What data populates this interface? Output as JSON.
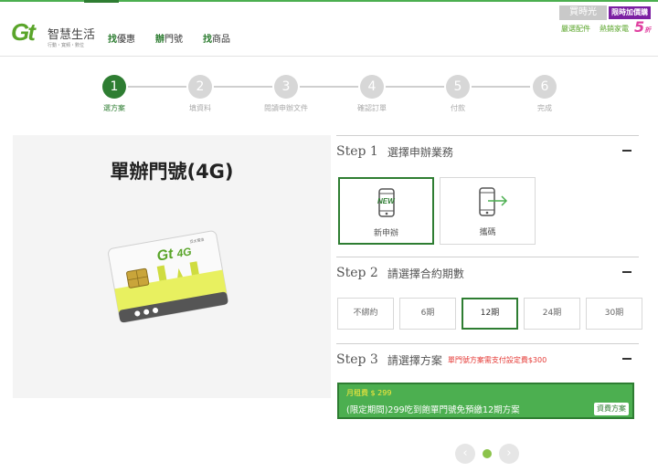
{
  "header": {
    "logo": {
      "mark": "Gt",
      "name": "智慧生活",
      "tagline": "行動・寬頻・數位"
    },
    "nav": [
      {
        "highlight": "找",
        "rest": "優惠"
      },
      {
        "highlight": "辦",
        "rest": "門號"
      },
      {
        "highlight": "找",
        "rest": "商品"
      }
    ],
    "promo": {
      "badge": "買時光",
      "limited": "限時加價購",
      "line1": "嚴選配件",
      "line2": "熱銷家電",
      "big": "5",
      "big_suffix": "折"
    }
  },
  "steps": [
    {
      "num": "1",
      "label": "選方案",
      "active": true
    },
    {
      "num": "2",
      "label": "填資料",
      "active": false
    },
    {
      "num": "3",
      "label": "閱讀申辦文件",
      "active": false
    },
    {
      "num": "4",
      "label": "確認訂單",
      "active": false
    },
    {
      "num": "5",
      "label": "付款",
      "active": false
    },
    {
      "num": "6",
      "label": "完成",
      "active": false
    }
  ],
  "product": {
    "title": "單辦門號(4G)",
    "card_brand": "亞太電信",
    "card_logo": "Gt",
    "card_4g": "4G"
  },
  "sections": {
    "step1": {
      "stepno": "Step 1",
      "title": "選擇申辦業務",
      "options": [
        {
          "label": "新申辦",
          "icon": "new-phone-icon",
          "badge": "NEW",
          "active": true
        },
        {
          "label": "攜碼",
          "icon": "transfer-phone-icon",
          "active": false
        }
      ]
    },
    "step2": {
      "stepno": "Step 2",
      "title": "請選擇合約期數",
      "options": [
        {
          "label": "不綁約",
          "active": false
        },
        {
          "label": "6期",
          "active": false
        },
        {
          "label": "12期",
          "active": true
        },
        {
          "label": "24期",
          "active": false
        },
        {
          "label": "30期",
          "active": false
        }
      ]
    },
    "step3": {
      "stepno": "Step 3",
      "title": "請選擇方案",
      "note": "單門號方案需支付設定費$300",
      "plan": {
        "fee": "月租費 $ 299",
        "name": "(限定期間)299吃到飽單門號免預繳12期方案",
        "detail": "資費方案"
      }
    }
  },
  "pager": {
    "prev": "‹",
    "next": "›"
  },
  "colors": {
    "brand_green": "#2e7d32",
    "plan_green": "#4caf50",
    "note_red": "#e53935"
  }
}
